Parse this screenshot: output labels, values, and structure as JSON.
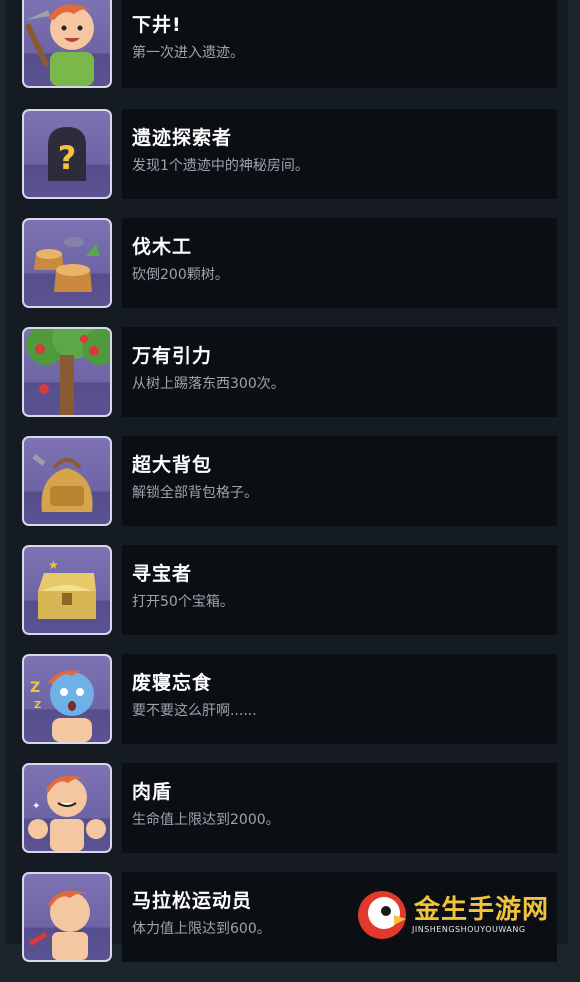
{
  "achievements": [
    {
      "icon": "pickaxe-boy-icon",
      "title": "下井!",
      "desc": "第一次进入遗迹。"
    },
    {
      "icon": "mystery-tombstone-icon",
      "title": "遗迹探索者",
      "desc": "发现1个遗迹中的神秘房间。"
    },
    {
      "icon": "tree-stump-icon",
      "title": "伐木工",
      "desc": "砍倒200颗树。"
    },
    {
      "icon": "apple-tree-icon",
      "title": "万有引力",
      "desc": "从树上踢落东西300次。"
    },
    {
      "icon": "backpack-icon",
      "title": "超大背包",
      "desc": "解锁全部背包格子。"
    },
    {
      "icon": "treasure-chest-icon",
      "title": "寻宝者",
      "desc": "打开50个宝箱。"
    },
    {
      "icon": "sleepy-boy-icon",
      "title": "废寝忘食",
      "desc": "要不要这么肝啊......"
    },
    {
      "icon": "muscle-boy-icon",
      "title": "肉盾",
      "desc": "生命值上限达到2000。"
    },
    {
      "icon": "runner-boy-icon",
      "title": "马拉松运动员",
      "desc": "体力值上限达到600。"
    }
  ],
  "watermark": {
    "name": "金生手游网",
    "domain": "JINSHENGSHOUYOUWANG"
  }
}
